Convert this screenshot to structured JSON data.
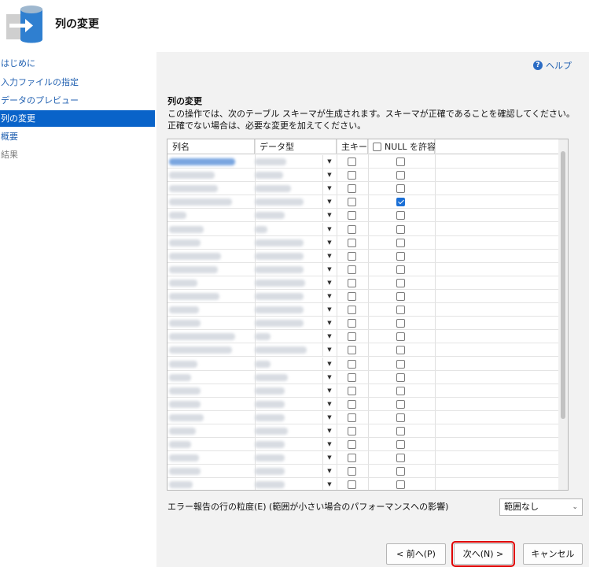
{
  "header": {
    "title": "列の変更",
    "icon": "database-import-icon"
  },
  "sidebar": {
    "items": [
      {
        "label": "はじめに",
        "state": "link"
      },
      {
        "label": "入力ファイルの指定",
        "state": "link"
      },
      {
        "label": "データのプレビュー",
        "state": "link"
      },
      {
        "label": "列の変更",
        "state": "active"
      },
      {
        "label": "概要",
        "state": "link"
      },
      {
        "label": "結果",
        "state": "disabled"
      }
    ]
  },
  "main": {
    "help_label": "ヘルプ",
    "section_title": "列の変更",
    "description": "この操作では、次のテーブル スキーマが生成されます。スキーマが正確であることを確認してください。正確でない場合は、必要な変更を加えてください。",
    "grid": {
      "columns": {
        "name": "列名",
        "type": "データ型",
        "primary_key": "主キー",
        "allow_null": "NULL を許容"
      },
      "null_checked_rows": [
        3
      ]
    },
    "error_granularity_label": "エラー報告の行の粒度(E) (範囲が小さい場合のパフォーマンスへの影響)",
    "error_granularity_value": "範囲なし"
  },
  "buttons": {
    "back": "< 前へ(P)",
    "next": "次へ(N) >",
    "cancel": "キャンセル"
  },
  "colors": {
    "accent": "#0963c9",
    "link": "#1f5fb0",
    "highlight": "#e00000"
  }
}
